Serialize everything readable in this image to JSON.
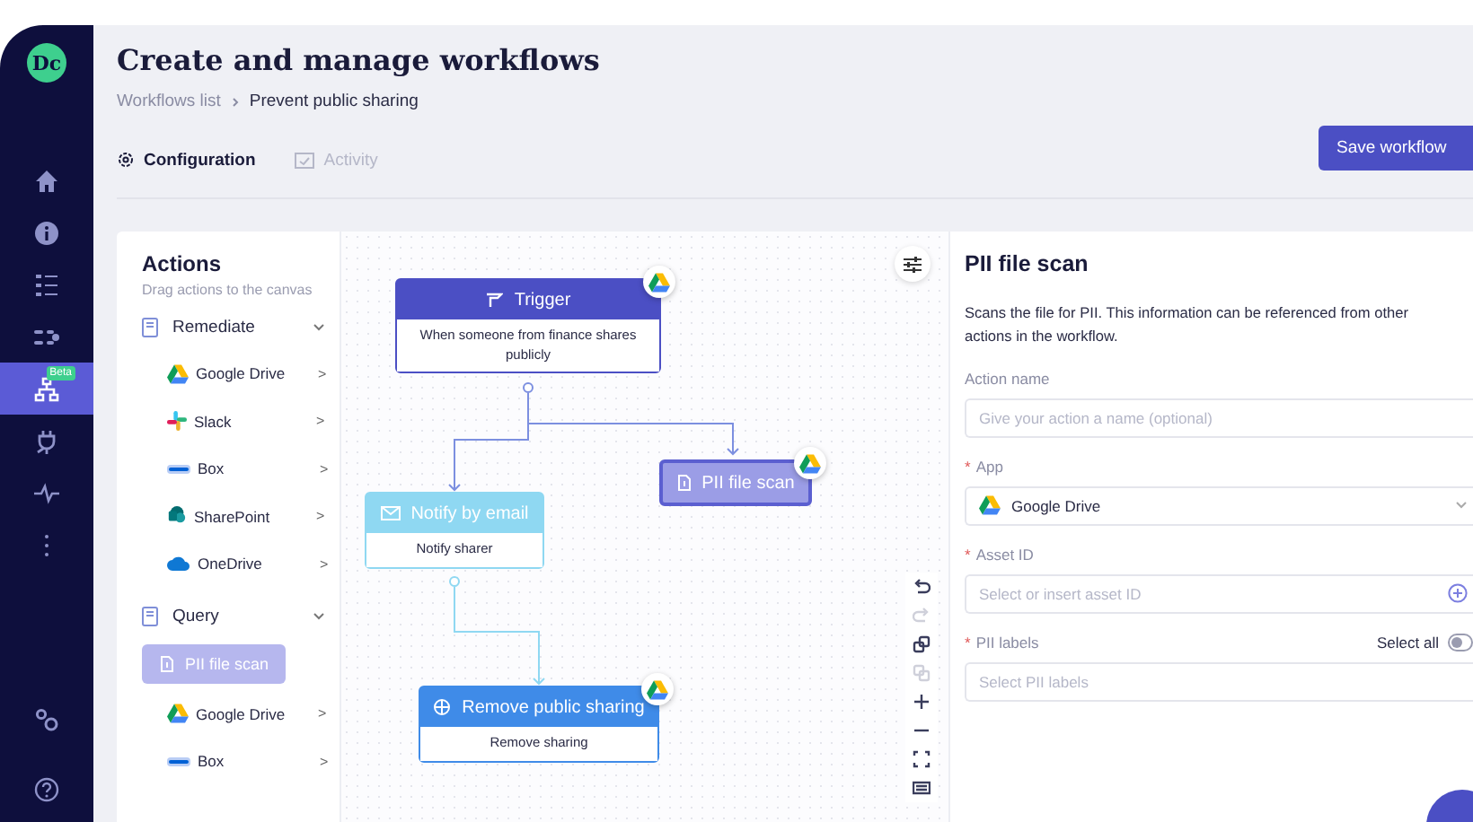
{
  "logo": "Dc",
  "nav": [
    {
      "kind": "home",
      "selected": false
    },
    {
      "kind": "info",
      "selected": false
    },
    {
      "kind": "list",
      "selected": false
    },
    {
      "kind": "flow",
      "selected": false
    },
    {
      "kind": "workflows",
      "selected": true,
      "badge": "Beta"
    },
    {
      "kind": "plug",
      "selected": false
    },
    {
      "kind": "pulse",
      "selected": false
    },
    {
      "kind": "more",
      "selected": false
    }
  ],
  "nav_bottom": [
    {
      "kind": "settings",
      "selected": false
    },
    {
      "kind": "help",
      "selected": false
    }
  ],
  "header": {
    "title": "Create and manage workflows",
    "breadcrumb": [
      "Workflows list",
      "Prevent public sharing"
    ]
  },
  "tabs": [
    {
      "label": "Configuration",
      "selected": true
    },
    {
      "label": "Activity",
      "selected": false
    }
  ],
  "save_button": "Save workflow",
  "actions": {
    "title": "Actions",
    "subtitle": "Drag actions to the canvas",
    "groups": [
      {
        "label": "Remediate",
        "expanded": true,
        "items": [
          {
            "kind": "gdrive",
            "label": "Google Drive",
            "arrow": ">"
          },
          {
            "kind": "slack",
            "label": "Slack",
            "arrow": ">"
          },
          {
            "kind": "box",
            "label": "Box",
            "arrow": ">"
          },
          {
            "kind": "sharepoint",
            "label": "SharePoint",
            "arrow": ">"
          },
          {
            "kind": "onedrive",
            "label": "OneDrive",
            "arrow": ">"
          }
        ]
      },
      {
        "label": "Query",
        "expanded": true,
        "items": [
          {
            "kind": "action",
            "label": "PII file scan"
          },
          {
            "kind": "gdrive",
            "label": "Google Drive",
            "arrow": ">"
          },
          {
            "kind": "box",
            "label": "Box",
            "arrow": ">"
          }
        ]
      }
    ]
  },
  "canvas": {
    "nodes": [
      {
        "kind": "trigger",
        "title": "Trigger",
        "selected": false,
        "body": "When someone from finance shares publicly"
      },
      {
        "kind": "scan",
        "title": "PII file scan",
        "selected": true
      },
      {
        "kind": "email",
        "title": "Notify by email",
        "selected": false,
        "body": "Notify sharer"
      },
      {
        "kind": "remove",
        "title": "Remove public sharing",
        "selected": false,
        "body": "Remove sharing"
      }
    ],
    "tools": [
      {
        "kind": "undo",
        "disabled": false
      },
      {
        "kind": "redo",
        "disabled": true
      },
      {
        "kind": "copy",
        "disabled": false
      },
      {
        "kind": "paste",
        "disabled": true
      },
      {
        "kind": "zoom-in",
        "disabled": false
      },
      {
        "kind": "zoom-out",
        "disabled": false
      },
      {
        "kind": "fit",
        "disabled": false
      },
      {
        "kind": "minimap",
        "disabled": false
      }
    ]
  },
  "details": {
    "title": "PII file scan",
    "description": "Scans the file for PII. This information can be referenced from other actions in the workflow.",
    "fields": [
      {
        "kind": "text",
        "label": "Action name",
        "placeholder": "Give your action a name (optional)"
      },
      {
        "kind": "select",
        "marker": "*",
        "label": "App",
        "value": "Google Drive"
      },
      {
        "kind": "asset",
        "marker": "*",
        "label": "Asset ID",
        "placeholder": "Select or insert asset ID"
      },
      {
        "kind": "labels",
        "marker": "*",
        "label": "PII labels",
        "placeholder": "Select PII labels",
        "toggle_label": "Select all",
        "toggle_on": false
      }
    ]
  }
}
